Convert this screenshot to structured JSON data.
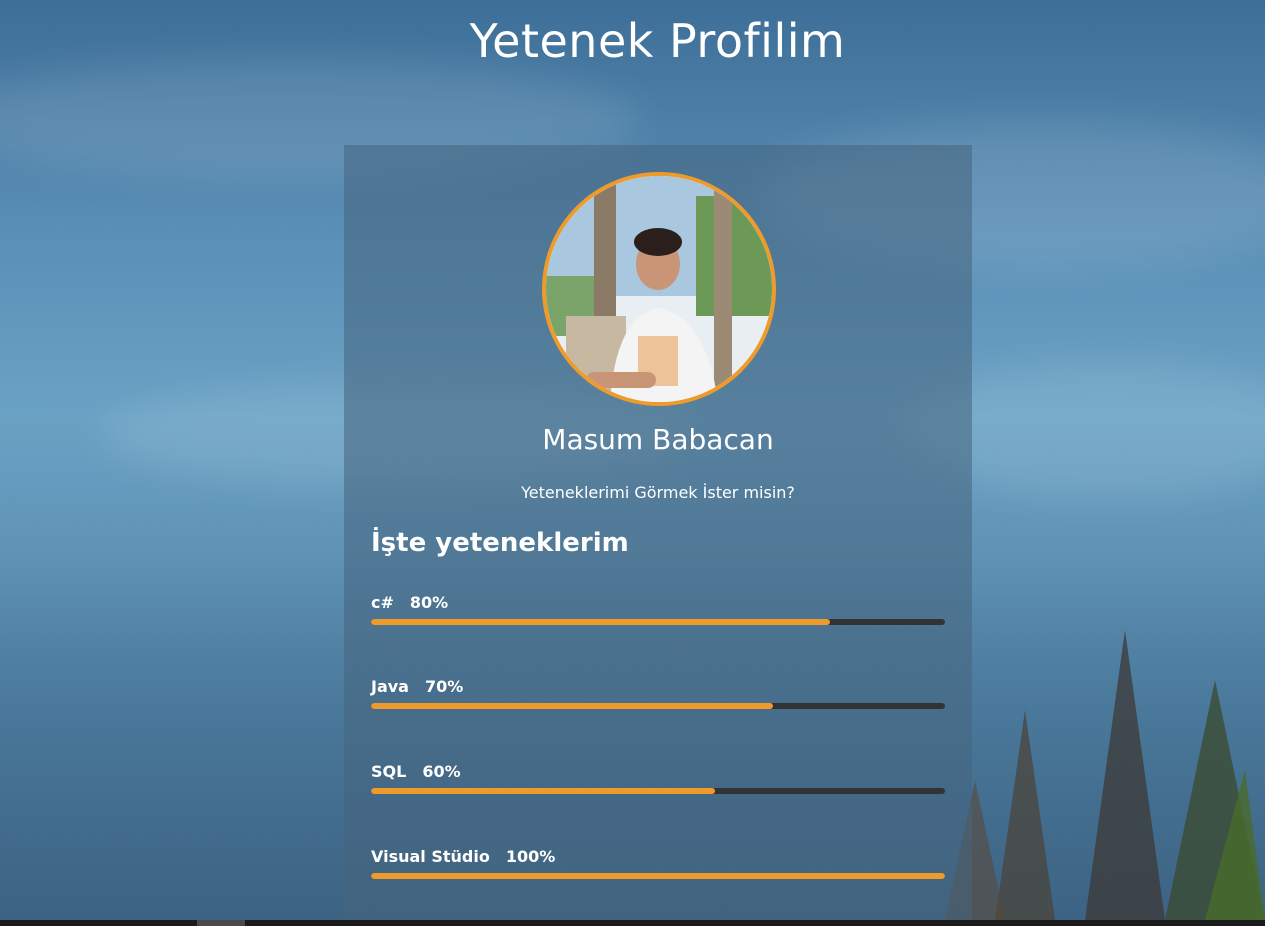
{
  "page": {
    "title": "Yetenek Profilim"
  },
  "profile": {
    "name": "Masum Babacan",
    "subtitle": "Yeteneklerimi Görmek İster misin?",
    "avatar_border_color": "#ee9b2c"
  },
  "skills": {
    "heading": "İşte yeteneklerim",
    "items": [
      {
        "name": "c#",
        "percent_label": "80%",
        "level": 0.8
      },
      {
        "name": "Java",
        "percent_label": "70%",
        "level": 0.7
      },
      {
        "name": "SQL",
        "percent_label": "60%",
        "level": 0.6
      },
      {
        "name": "Visual Stüdio",
        "percent_label": "100%",
        "level": 1.0
      }
    ]
  },
  "colors": {
    "accent": "#ee9b2c",
    "track": "#333333",
    "card": "rgba(70,100,125,0.55)"
  }
}
